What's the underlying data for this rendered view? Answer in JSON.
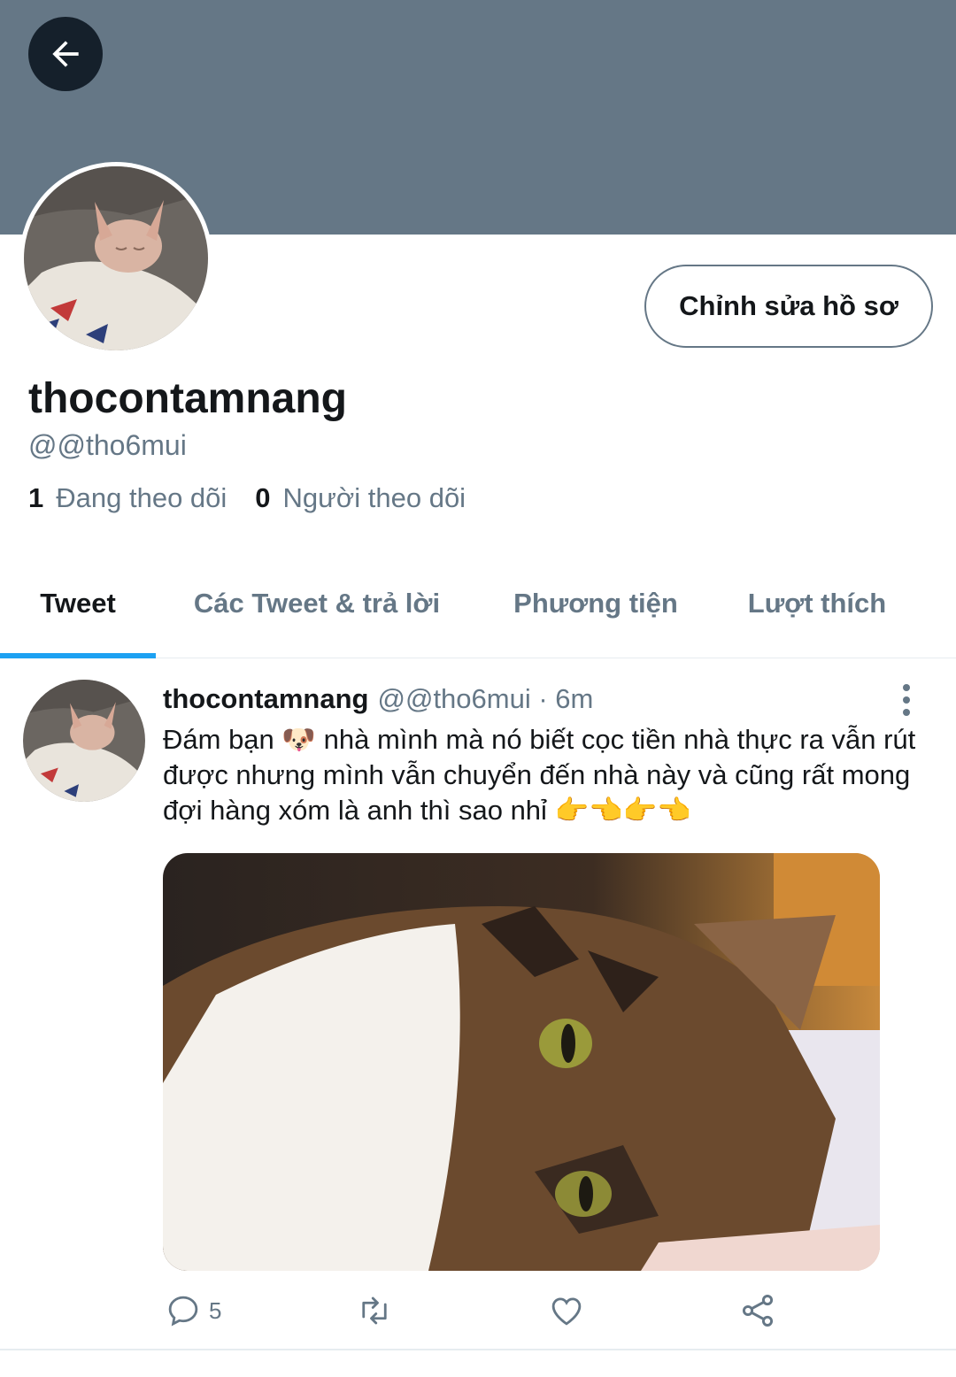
{
  "profile": {
    "display_name": "thocontamnang",
    "handle": "@@tho6mui",
    "edit_label": "Chỉnh sửa hồ sơ",
    "following_count": "1",
    "following_label": "Đang theo dõi",
    "followers_count": "0",
    "followers_label": "Người theo dõi"
  },
  "tabs": [
    {
      "label": "Tweet",
      "active": true
    },
    {
      "label": "Các Tweet & trả lời",
      "active": false
    },
    {
      "label": "Phương tiện",
      "active": false
    },
    {
      "label": "Lượt thích",
      "active": false
    }
  ],
  "tweet": {
    "name": "thocontamnang",
    "meta": "@@tho6mui · 6m",
    "text": "Đám bạn 🐶 nhà mình mà nó biết cọc tiền nhà thực ra vẫn rút được nhưng mình vẫn chuyển đến nhà này và cũng rất mong đợi hàng xóm là anh thì sao nhỉ 👉👈👉👈",
    "reply_count": "5"
  },
  "colors": {
    "banner": "#657786",
    "accent": "#1da1f2",
    "secondary_text": "#657786"
  },
  "icons": [
    "back-arrow-icon",
    "more-vertical-icon",
    "reply-icon",
    "retweet-icon",
    "like-icon",
    "share-icon"
  ]
}
